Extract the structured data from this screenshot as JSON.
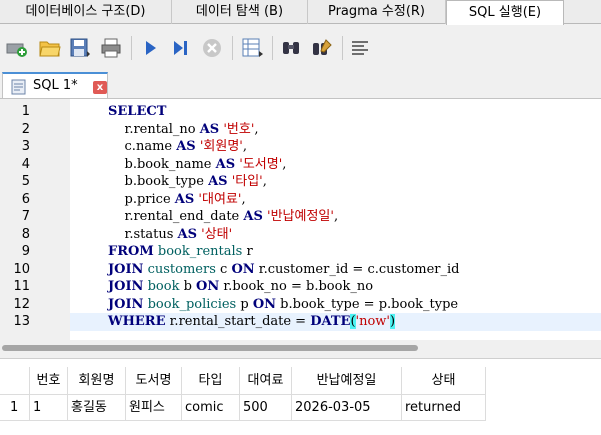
{
  "top_tabs": [
    "데이터베이스 구조(D)",
    "데이터 탐색 (B)",
    "Pragma 수정(R)",
    "SQL 실행(E)"
  ],
  "editor_tab": {
    "label": "SQL 1*",
    "close": "x"
  },
  "code_lines": [
    {
      "n": "1",
      "html": "<span class=\"kw\">SELECT</span>"
    },
    {
      "n": "2",
      "html": "    r.rental_no <span class=\"kw\">AS</span> <span class=\"str\">'번호'</span>,"
    },
    {
      "n": "3",
      "html": "    c.name <span class=\"kw\">AS</span> <span class=\"str\">'회원명'</span>,"
    },
    {
      "n": "4",
      "html": "    b.book_name <span class=\"kw\">AS</span> <span class=\"str\">'도서명'</span>,"
    },
    {
      "n": "5",
      "html": "    b.book_type <span class=\"kw\">AS</span> <span class=\"str\">'타입'</span>,"
    },
    {
      "n": "6",
      "html": "    p.price <span class=\"kw\">AS</span> <span class=\"str\">'대여료'</span>,"
    },
    {
      "n": "7",
      "html": "    r.rental_end_date <span class=\"kw\">AS</span> <span class=\"str\">'반납예정일'</span>,"
    },
    {
      "n": "8",
      "html": "    r.status <span class=\"kw\">AS</span> <span class=\"str\">'상태'</span>"
    },
    {
      "n": "9",
      "html": "<span class=\"kw\">FROM</span> <span class=\"ident\">book_rentals</span> r"
    },
    {
      "n": "10",
      "html": "<span class=\"kw\">JOIN</span> <span class=\"ident\">customers</span> c <span class=\"kw\">ON</span> r.customer_id = c.customer_id"
    },
    {
      "n": "11",
      "html": "<span class=\"kw\">JOIN</span> <span class=\"ident\">book</span> b <span class=\"kw\">ON</span> r.book_no = b.book_no"
    },
    {
      "n": "12",
      "html": "<span class=\"kw\">JOIN</span> <span class=\"ident\">book_policies</span> p <span class=\"kw\">ON</span> b.book_type = p.book_type"
    },
    {
      "n": "13",
      "html": "<span class=\"kw\">WHERE</span> r.rental_start_date = <span class=\"kw\">DATE</span><span class=\"bracket\">(</span><span class=\"str\">'now'</span><span class=\"bracket\">)</span>"
    }
  ],
  "results": {
    "headers": [
      "번호",
      "회원명",
      "도서명",
      "타입",
      "대여료",
      "반납예정일",
      "상태"
    ],
    "rows": [
      {
        "rownum": "1",
        "cells": [
          "1",
          "홍길동",
          "원피스",
          "comic",
          "500",
          "2026-03-05",
          "returned"
        ]
      }
    ]
  }
}
